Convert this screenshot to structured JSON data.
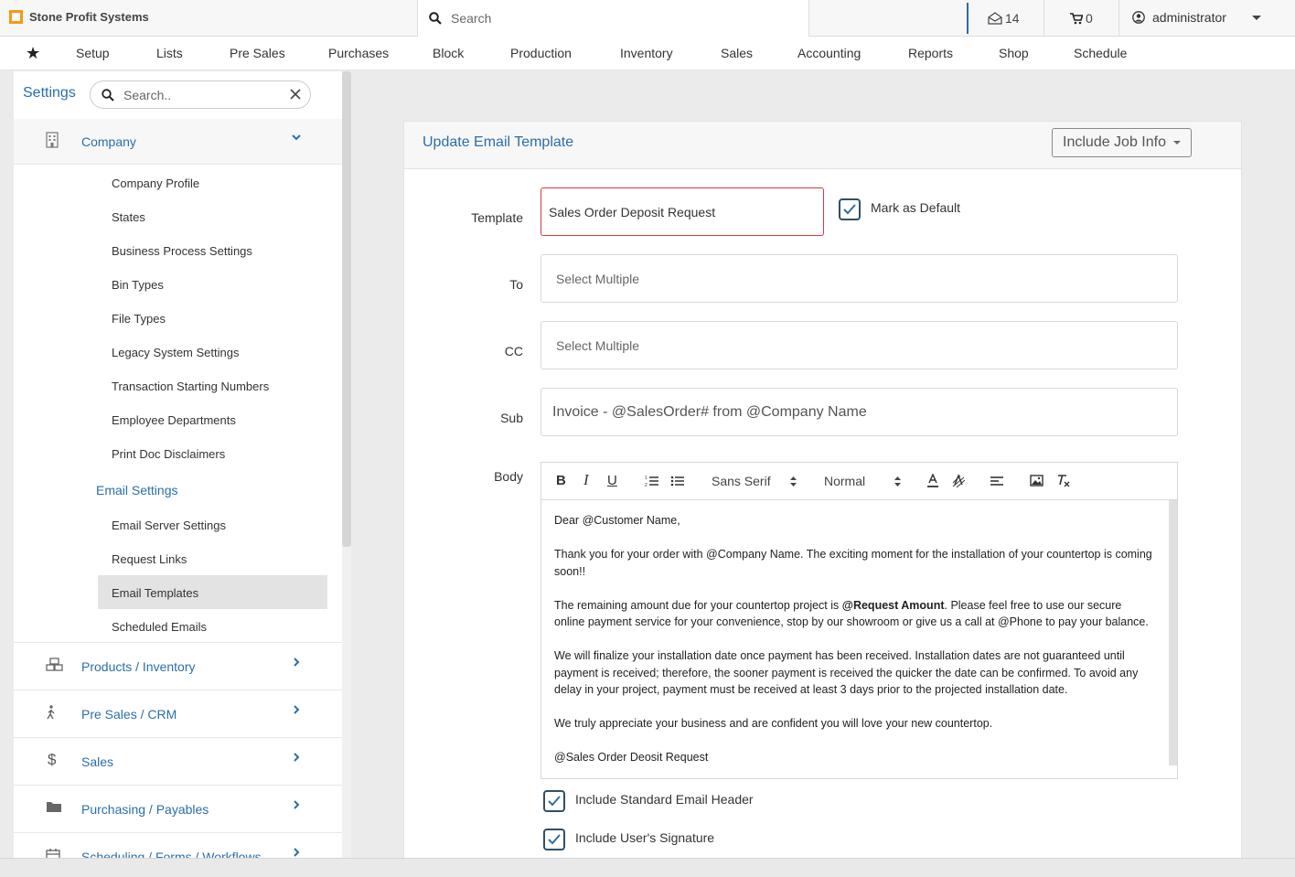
{
  "app": {
    "name": "Stone Profit Systems"
  },
  "topbar": {
    "search_placeholder": "Search",
    "messages_count": "14",
    "cart_count": "0",
    "user_name": "administrator"
  },
  "menu": [
    "Setup",
    "Lists",
    "Pre Sales",
    "Purchases",
    "Block",
    "Production",
    "Inventory",
    "Sales",
    "Accounting",
    "Reports",
    "Shop",
    "Schedule"
  ],
  "sidebar": {
    "title": "Settings",
    "search_placeholder": "Search..",
    "company_label": "Company",
    "company_items": [
      "Company Profile",
      "States",
      "Business Process Settings",
      "Bin Types",
      "File Types",
      "Legacy System Settings",
      "Transaction Starting Numbers",
      "Employee Departments",
      "Print Doc Disclaimers"
    ],
    "email_settings_label": "Email Settings",
    "email_items": [
      "Email Server Settings",
      "Request Links",
      "Email Templates",
      "Scheduled Emails"
    ],
    "categories": [
      "Products / Inventory",
      "Pre Sales / CRM",
      "Sales",
      "Purchasing / Payables",
      "Scheduling / Forms / Workflows"
    ]
  },
  "form": {
    "title": "Update Email Template",
    "job_info_button": "Include Job Info",
    "template_label": "Template",
    "template_value": "Sales Order Deposit Request",
    "mark_default_label": "Mark as Default",
    "to_label": "To",
    "to_placeholder": "Select Multiple",
    "cc_label": "CC",
    "cc_placeholder": "Select Multiple",
    "sub_label": "Sub",
    "sub_value": "Invoice - @SalesOrder# from @Company Name",
    "body_label": "Body",
    "font_family": "Sans Serif",
    "font_size": "Normal",
    "body": {
      "p1": "Dear @Customer Name,",
      "p2": "Thank you for your order with @Company Name. The exciting moment for the installation of your countertop is coming soon!!",
      "p3_pre": "The remaining amount due for your countertop project is ",
      "p3_bold": "@Request Amount",
      "p3_post": ". Please feel free to use our secure online payment service for your convenience, stop by our showroom or give us a call at @Phone to pay your balance.",
      "p4": "We will finalize your installation date once payment has been received. Installation dates are not guaranteed until payment is received; therefore, the sooner payment is received the quicker the date can be confirmed. To avoid any delay in your project, payment must be received at least 3 days prior to the projected installation date.",
      "p5": "We truly appreciate your business and are confident you will love your new countertop.",
      "p6": "@Sales Order Deosit Request"
    },
    "include_header_label": "Include Standard Email Header",
    "include_signature_label": "Include User's Signature"
  },
  "colors": {
    "link": "#2a6fa8",
    "error_border": "#d9363e",
    "logo": "#f39c12"
  }
}
